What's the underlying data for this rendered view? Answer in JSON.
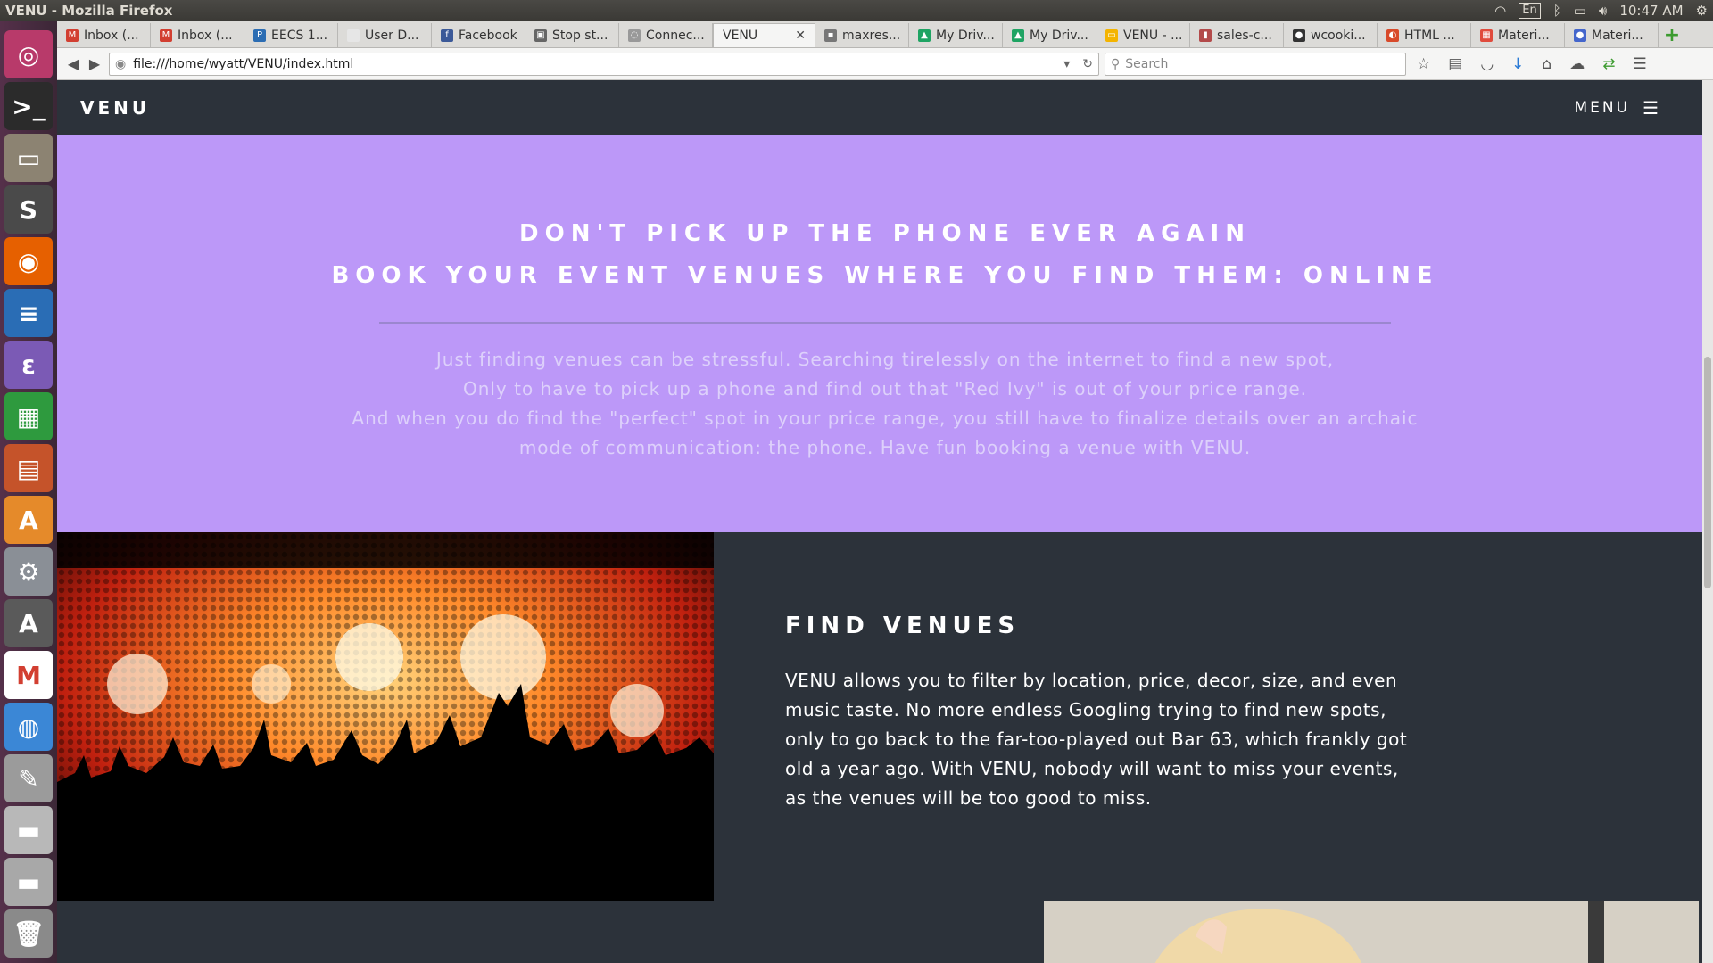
{
  "system": {
    "window_title": "VENU - Mozilla Firefox",
    "keyboard_layout": "En",
    "clock": "10:47 AM"
  },
  "launcher": {
    "items": [
      {
        "name": "ubuntu-dash-icon",
        "glyph": "◎",
        "color": "#b83a6a"
      },
      {
        "name": "terminal-icon",
        "glyph": ">_",
        "color": "#2b2b2b"
      },
      {
        "name": "file-manager-icon",
        "glyph": "▭",
        "color": "#8c8372"
      },
      {
        "name": "sublime-text-icon",
        "glyph": "S",
        "color": "#4a4a4a"
      },
      {
        "name": "firefox-icon",
        "glyph": "◉",
        "color": "#e66000"
      },
      {
        "name": "writer-icon",
        "glyph": "≡",
        "color": "#2a6db5"
      },
      {
        "name": "emacs-icon",
        "glyph": "ε",
        "color": "#7b5ab5"
      },
      {
        "name": "calc-icon",
        "glyph": "▦",
        "color": "#2e9a3e"
      },
      {
        "name": "impress-icon",
        "glyph": "▤",
        "color": "#c5532a"
      },
      {
        "name": "software-center-icon",
        "glyph": "A",
        "color": "#e58a2a"
      },
      {
        "name": "settings-icon",
        "glyph": "⚙",
        "color": "#8a8f96"
      },
      {
        "name": "software-updater-icon",
        "glyph": "A",
        "color": "#5a5a5a"
      },
      {
        "name": "gmail-icon",
        "glyph": "M",
        "color": "#ffffff"
      },
      {
        "name": "chromium-icon",
        "glyph": "◍",
        "color": "#3b87d6"
      },
      {
        "name": "text-editor-icon",
        "glyph": "✎",
        "color": "#9b9b9b"
      },
      {
        "name": "drive-icon",
        "glyph": "▬",
        "color": "#b8b8b8"
      },
      {
        "name": "drive-2-icon",
        "glyph": "▬",
        "color": "#a8a8a8"
      },
      {
        "name": "trash-icon",
        "glyph": "🗑",
        "color": "#8a8a8a"
      }
    ]
  },
  "tabs": [
    {
      "label": "Inbox (...",
      "fav": "M",
      "color": "#d23f31"
    },
    {
      "label": "Inbox (...",
      "fav": "M",
      "color": "#d23f31"
    },
    {
      "label": "EECS 1...",
      "fav": "P",
      "color": "#2c6db3"
    },
    {
      "label": "User D...",
      "fav": "",
      "color": "#e6e6e6"
    },
    {
      "label": "Facebook",
      "fav": "f",
      "color": "#3b5998"
    },
    {
      "label": "Stop st...",
      "fav": "▣",
      "color": "#666666"
    },
    {
      "label": "Connec...",
      "fav": "◌",
      "color": "#999999"
    },
    {
      "label": "VENU",
      "fav": "",
      "color": "#f5f5f4",
      "active": true
    },
    {
      "label": "maxres...",
      "fav": "▪",
      "color": "#777777"
    },
    {
      "label": "My Driv...",
      "fav": "▲",
      "color": "#1fa463"
    },
    {
      "label": "My Driv...",
      "fav": "▲",
      "color": "#1fa463"
    },
    {
      "label": "VENU - ...",
      "fav": "▭",
      "color": "#f4b400"
    },
    {
      "label": "sales-c...",
      "fav": "▮",
      "color": "#b34a4a"
    },
    {
      "label": "wcooki...",
      "fav": "●",
      "color": "#333333"
    },
    {
      "label": "HTML ...",
      "fav": "◐",
      "color": "#d84a2a"
    },
    {
      "label": "Materi...",
      "fav": "▦",
      "color": "#e04b3c"
    },
    {
      "label": "Materi...",
      "fav": "●",
      "color": "#4466cc"
    }
  ],
  "navbar": {
    "url": "file:///home/wyatt/VENU/index.html",
    "search_placeholder": "Search"
  },
  "site": {
    "brand": "VENU",
    "menu_label": "MENU",
    "hero": {
      "headline_1": "DON'T PICK UP THE PHONE EVER AGAIN",
      "headline_2": "BOOK YOUR EVENT VENUES WHERE YOU FIND THEM: ONLINE",
      "paragraph_lines": [
        "Just finding venues can be stressful. Searching tirelessly on the internet to find a new spot,",
        "Only to have to pick up a phone and find out that \"Red Ivy\" is out of your price range.",
        "And when you do find the \"perfect\" spot in your price range, you still have to finalize details over an archaic",
        "mode of communication: the phone. Have fun booking a venue with VENU."
      ]
    },
    "feature": {
      "title": "FIND VENUES",
      "body": "VENU allows you to filter by location, price, decor, size, and even music taste. No more endless Googling trying to find new spots, only to go back to the far-too-played out Bar 63, which frankly got old a year ago. With VENU, nobody will want to miss your events, as the venues will be too good to miss."
    }
  },
  "colors": {
    "hero_bg": "#bc98f8",
    "dark_bg": "#2c323a"
  }
}
